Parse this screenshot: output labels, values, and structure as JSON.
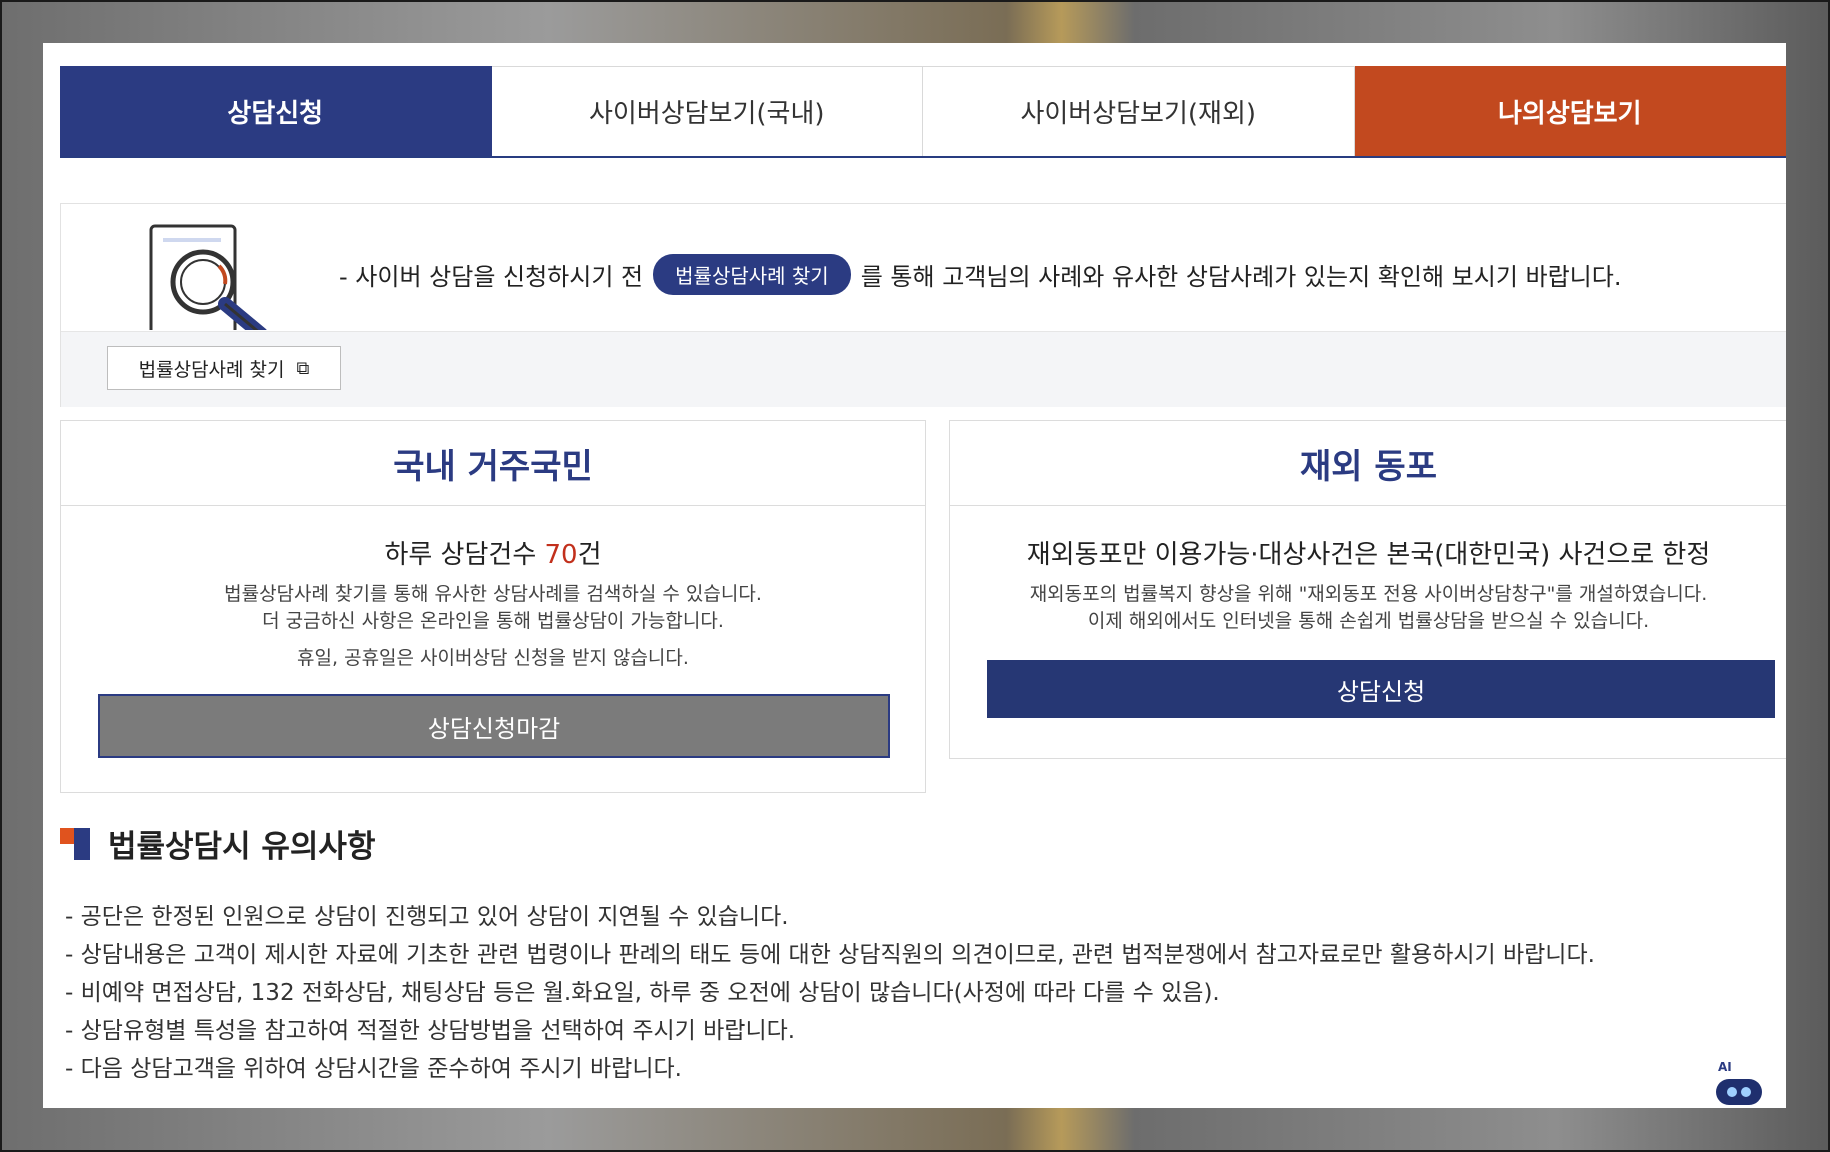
{
  "tabs": [
    {
      "label": "상담신청"
    },
    {
      "label": "사이버상담보기(국내)"
    },
    {
      "label": "사이버상담보기(재외)"
    },
    {
      "label": "나의상담보기"
    }
  ],
  "notice": {
    "prefix": "- 사이버 상담을 신청하시기 전",
    "pill_label": "법률상담사례 찾기",
    "suffix": "를 통해 고객님의 사례와 유사한 상담사례가 있는지 확인해 보시기 바랍니다.",
    "find_button": "법률상담사례 찾기",
    "find_icon": "external-link-icon"
  },
  "domestic": {
    "title": "국내 거주국민",
    "sub_prefix": "하루 상담건수 ",
    "count": "70",
    "sub_suffix": "건",
    "desc1": "법률상담사례 찾기를 통해 유사한 상담사례를 검색하실 수 있습니다.",
    "desc2": "더 궁금하신 사항은 온라인을 통해 법률상담이 가능합니다.",
    "desc3": "휴일, 공휴일은 사이버상담 신청을 받지 않습니다.",
    "button": "상담신청마감"
  },
  "overseas": {
    "title": "재외 동포",
    "sub": "재외동포만 이용가능·대상사건은 본국(대한민국) 사건으로 한정",
    "desc1": "재외동포의 법률복지 향상을 위해 \"재외동포 전용 사이버상담창구\"를 개설하였습니다.",
    "desc2": "이제 해외에서도 인터넷을 통해 손쉽게 법률상담을 받으실 수 있습니다.",
    "button": "상담신청"
  },
  "caution": {
    "title": "법률상담시 유의사항",
    "items": [
      "공단은 한정된 인원으로 상담이 진행되고 있어 상담이 지연될 수 있습니다.",
      "상담내용은 고객이 제시한 자료에 기초한 관련 법령이나 판례의 태도 등에 대한 상담직원의 의견이므로, 관련 법적분쟁에서 참고자료로만 활용하시기 바랍니다.",
      "비예약 면접상담, 132 전화상담, 채팅상담 등은 월.화요일, 하루 중 오전에 상담이 많습니다(사정에 따라 다를 수 있음).",
      "상담유형별 특성을 참고하여 적절한 상담방법을 선택하여 주시기 바랍니다.",
      "다음 상담고객을 위하여 상담시간을 준수하여 주시기 바랍니다."
    ]
  },
  "ai_badge": "AI",
  "colors": {
    "primary": "#2b3b82",
    "accent": "#c2491f",
    "count": "#c2301c",
    "closed": "#7b7b7b"
  }
}
